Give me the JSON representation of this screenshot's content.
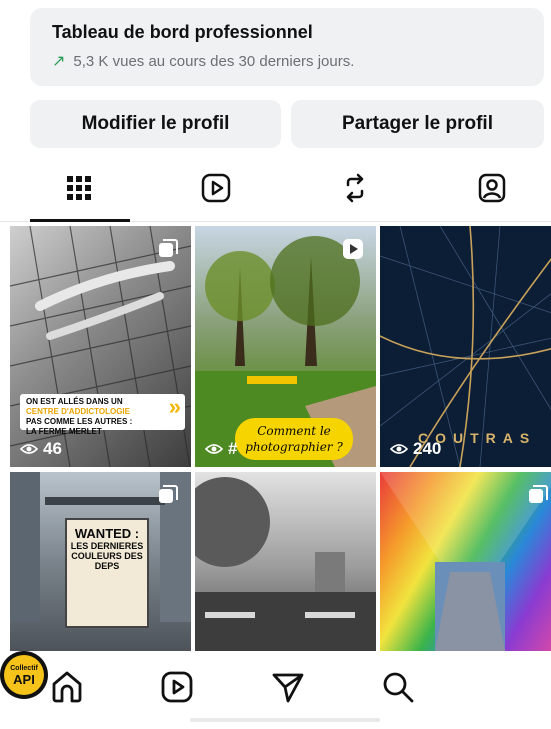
{
  "dashboard": {
    "title": "Tableau de bord professionnel",
    "arrow_icon": "trend-up-arrow-icon",
    "stats": "5,3 K vues au cours des 30 derniers jours."
  },
  "actions": {
    "edit_profile": "Modifier le profil",
    "share_profile": "Partager le profil"
  },
  "tabs": [
    {
      "name": "grid",
      "icon": "grid-icon",
      "active": true
    },
    {
      "name": "reels",
      "icon": "reels-icon",
      "active": false
    },
    {
      "name": "reposts",
      "icon": "repost-icon",
      "active": false
    },
    {
      "name": "tagged",
      "icon": "tagged-person-icon",
      "active": false
    }
  ],
  "posts": [
    {
      "type": "carousel",
      "views": "46",
      "banner_line1": "ON EST ALLÉS DANS UN",
      "banner_line2": "CENTRE D'ADDICTOLOGIE",
      "banner_line3": "PAS COMME LES AUTRES :",
      "banner_line4": "LA FERME MERLET"
    },
    {
      "type": "reel",
      "views": "#",
      "bubble_line1": "Comment le",
      "bubble_line2": "photographier ?"
    },
    {
      "type": "image",
      "views": "240",
      "city": "COUTRAS"
    },
    {
      "type": "carousel",
      "poster_title": "WANTED :",
      "poster_line1": "LES DERNIERES",
      "poster_line2": "COULEURS DES DEPS"
    },
    {
      "type": "image"
    },
    {
      "type": "carousel"
    }
  ],
  "navbar": {
    "items": [
      "home-icon",
      "reels-icon",
      "direct-message-icon",
      "search-icon",
      "profile-avatar"
    ],
    "avatar_text_top": "Collectif",
    "avatar_text_main": "API"
  },
  "colors": {
    "card_bg": "#eff1f3",
    "trend_green": "#2a9d55",
    "accent_yellow": "#f5d400"
  }
}
